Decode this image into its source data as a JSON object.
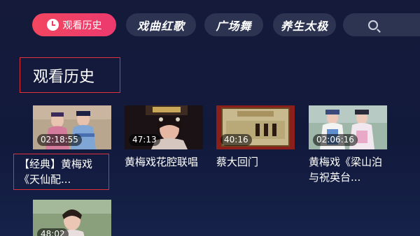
{
  "tabs": [
    {
      "label": "观看历史",
      "active": true
    },
    {
      "label": "戏曲红歌",
      "active": false
    },
    {
      "label": "广场舞",
      "active": false
    },
    {
      "label": "养生太极",
      "active": false
    }
  ],
  "search": {
    "icon": "search-icon"
  },
  "section": {
    "title": "观看历史"
  },
  "videos": [
    {
      "title": "【经典】黄梅戏《天仙配...",
      "duration": "02:18:55"
    },
    {
      "title": "黄梅戏花腔联唱",
      "duration": "47:13"
    },
    {
      "title": "蔡大回门",
      "duration": "40:16"
    },
    {
      "title": "黄梅戏《梁山泊与祝英台...",
      "duration": "02:06:16"
    },
    {
      "title": "",
      "duration": "48:02"
    }
  ],
  "colors": {
    "accent": "#f0405f",
    "background": "#141b3d",
    "tab_bg": "#2c3452"
  }
}
